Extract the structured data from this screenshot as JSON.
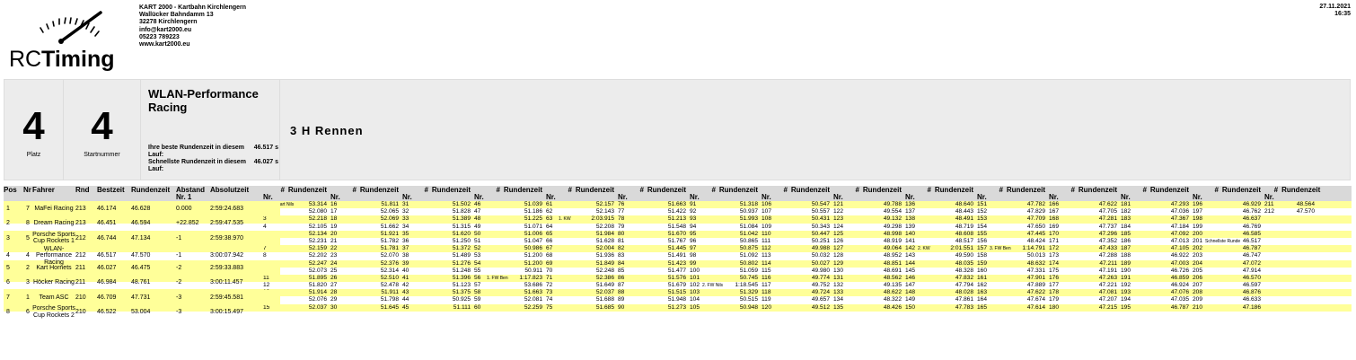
{
  "header": {
    "club_lines": [
      "KART 2000 - Kartbahn Kirchlengern",
      "Wallücker Bahndamm 13",
      "32278 Kirchlengern",
      "info@kart2000.eu",
      "05223 789223",
      "www.kart2000.eu"
    ],
    "date": "27.11.2021",
    "time": "16:35",
    "logo_text_rc": "RC",
    "logo_text_timing": "Timing"
  },
  "info": {
    "place": "4",
    "place_label": "Platz",
    "start_number": "4",
    "start_label": "Startnummer",
    "team_name": "WLAN-Performance Racing",
    "best_lap_label": "Ihre beste Rundenzeit in diesem Lauf:",
    "best_lap_value": "46.517 s",
    "fastest_lap_label": "Schnellste Rundenzeit in diesem Lauf:",
    "fastest_lap_value": "46.027 s",
    "race_title": "3 H Rennen"
  },
  "standings": {
    "headers": [
      "Pos",
      "Nr",
      "Fahrer",
      "Rnd",
      "Bestzeit",
      "Rundenzeit",
      "Abstand Nr. 1",
      "Absolutzeit"
    ],
    "rows": [
      [
        "1",
        "7",
        "MaFei Racing",
        "213",
        "46.174",
        "46.628",
        "0.000",
        "2:59:24.683"
      ],
      [
        "2",
        "8",
        "Dream Racing",
        "213",
        "46.451",
        "46.594",
        "+22.852",
        "2:59:47.535"
      ],
      [
        "3",
        "5",
        "Porsche Sports Cup Rockets 1",
        "212",
        "46.744",
        "47.134",
        "-1",
        "2:59:38.970"
      ],
      [
        "4",
        "4",
        "WLAN-Performance Racing",
        "212",
        "46.517",
        "47.570",
        "-1",
        "3:00:07.942"
      ],
      [
        "5",
        "2",
        "Kart Hornets",
        "211",
        "46.027",
        "46.475",
        "-2",
        "2:59:33.883"
      ],
      [
        "6",
        "3",
        "Höcker Racing",
        "211",
        "46.984",
        "48.761",
        "-2",
        "3:00:11.457"
      ],
      [
        "7",
        "1",
        "Team ASC",
        "210",
        "46.709",
        "47.731",
        "-3",
        "2:59:45.581"
      ],
      [
        "8",
        "6",
        "Porsche Sports Cup Rockets 2",
        "210",
        "46.522",
        "53.004",
        "-3",
        "3:00:15.497"
      ]
    ]
  },
  "laps": {
    "col_num_label": "#",
    "col_nr_label": "Nr.",
    "col_time_label": "Rundenzeit",
    "columns": [
      [
        [
          "1",
          "53.314",
          "Start Nils"
        ],
        [
          "2",
          "52.080",
          ""
        ],
        [
          "3",
          "52.218",
          ""
        ],
        [
          "4",
          "52.105",
          ""
        ],
        [
          "5",
          "52.134",
          ""
        ],
        [
          "6",
          "52.231",
          ""
        ],
        [
          "7",
          "52.159",
          ""
        ],
        [
          "8",
          "52.202",
          ""
        ],
        [
          "9",
          "52.247",
          ""
        ],
        [
          "10",
          "52.073",
          ""
        ],
        [
          "11",
          "51.895",
          ""
        ],
        [
          "12",
          "51.820",
          ""
        ],
        [
          "13",
          "51.914",
          ""
        ],
        [
          "14",
          "52.076",
          ""
        ],
        [
          "15",
          "52.037",
          ""
        ]
      ],
      [
        [
          "16",
          "51.811",
          ""
        ],
        [
          "17",
          "52.065",
          ""
        ],
        [
          "18",
          "52.069",
          ""
        ],
        [
          "19",
          "51.662",
          ""
        ],
        [
          "20",
          "51.921",
          ""
        ],
        [
          "21",
          "51.782",
          ""
        ],
        [
          "22",
          "51.781",
          ""
        ],
        [
          "23",
          "52.070",
          ""
        ],
        [
          "24",
          "52.376",
          ""
        ],
        [
          "25",
          "52.314",
          ""
        ],
        [
          "26",
          "52.510",
          ""
        ],
        [
          "27",
          "52.478",
          ""
        ],
        [
          "28",
          "51.911",
          ""
        ],
        [
          "29",
          "51.798",
          ""
        ],
        [
          "30",
          "51.645",
          ""
        ]
      ],
      [
        [
          "31",
          "51.502",
          ""
        ],
        [
          "32",
          "51.828",
          ""
        ],
        [
          "33",
          "51.389",
          ""
        ],
        [
          "34",
          "51.315",
          ""
        ],
        [
          "35",
          "51.620",
          ""
        ],
        [
          "36",
          "51.250",
          ""
        ],
        [
          "37",
          "51.372",
          ""
        ],
        [
          "38",
          "51.489",
          ""
        ],
        [
          "39",
          "51.276",
          ""
        ],
        [
          "40",
          "51.248",
          ""
        ],
        [
          "41",
          "51.396",
          ""
        ],
        [
          "42",
          "51.123",
          ""
        ],
        [
          "43",
          "51.375",
          ""
        ],
        [
          "44",
          "50.925",
          ""
        ],
        [
          "45",
          "51.111",
          ""
        ]
      ],
      [
        [
          "46",
          "51.039",
          ""
        ],
        [
          "47",
          "51.186",
          ""
        ],
        [
          "48",
          "51.225",
          ""
        ],
        [
          "49",
          "51.071",
          ""
        ],
        [
          "50",
          "51.006",
          ""
        ],
        [
          "51",
          "51.047",
          ""
        ],
        [
          "52",
          "50.986",
          ""
        ],
        [
          "53",
          "51.200",
          ""
        ],
        [
          "54",
          "51.200",
          ""
        ],
        [
          "55",
          "50.911",
          ""
        ],
        [
          "56",
          "1:17.823",
          "1. FW Ben"
        ],
        [
          "57",
          "53.686",
          ""
        ],
        [
          "58",
          "51.663",
          ""
        ],
        [
          "59",
          "52.081",
          ""
        ],
        [
          "60",
          "52.259",
          ""
        ]
      ],
      [
        [
          "61",
          "52.157",
          ""
        ],
        [
          "62",
          "52.143",
          ""
        ],
        [
          "63",
          "2:03.915",
          "1. KW"
        ],
        [
          "64",
          "52.208",
          ""
        ],
        [
          "65",
          "51.984",
          ""
        ],
        [
          "66",
          "51.628",
          ""
        ],
        [
          "67",
          "52.004",
          ""
        ],
        [
          "68",
          "51.936",
          ""
        ],
        [
          "69",
          "51.849",
          ""
        ],
        [
          "70",
          "52.248",
          ""
        ],
        [
          "71",
          "52.386",
          ""
        ],
        [
          "72",
          "51.649",
          ""
        ],
        [
          "73",
          "52.037",
          ""
        ],
        [
          "74",
          "51.688",
          ""
        ],
        [
          "75",
          "51.685",
          ""
        ]
      ],
      [
        [
          "76",
          "51.663",
          ""
        ],
        [
          "77",
          "51.422",
          ""
        ],
        [
          "78",
          "51.213",
          ""
        ],
        [
          "79",
          "51.548",
          ""
        ],
        [
          "80",
          "51.670",
          ""
        ],
        [
          "81",
          "51.767",
          ""
        ],
        [
          "82",
          "51.445",
          ""
        ],
        [
          "83",
          "51.491",
          ""
        ],
        [
          "84",
          "51.423",
          ""
        ],
        [
          "85",
          "51.477",
          ""
        ],
        [
          "86",
          "51.576",
          ""
        ],
        [
          "87",
          "51.679",
          ""
        ],
        [
          "88",
          "51.515",
          ""
        ],
        [
          "89",
          "51.948",
          ""
        ],
        [
          "90",
          "51.273",
          ""
        ]
      ],
      [
        [
          "91",
          "51.318",
          ""
        ],
        [
          "92",
          "50.937",
          ""
        ],
        [
          "93",
          "51.993",
          ""
        ],
        [
          "94",
          "51.084",
          ""
        ],
        [
          "95",
          "51.042",
          ""
        ],
        [
          "96",
          "50.865",
          ""
        ],
        [
          "97",
          "50.875",
          ""
        ],
        [
          "98",
          "51.092",
          ""
        ],
        [
          "99",
          "50.802",
          ""
        ],
        [
          "100",
          "51.059",
          ""
        ],
        [
          "101",
          "50.745",
          ""
        ],
        [
          "102",
          "1:18.545",
          "2. FW Nils"
        ],
        [
          "103",
          "51.329",
          ""
        ],
        [
          "104",
          "50.515",
          ""
        ],
        [
          "105",
          "50.948",
          ""
        ]
      ],
      [
        [
          "106",
          "50.547",
          ""
        ],
        [
          "107",
          "50.557",
          ""
        ],
        [
          "108",
          "50.431",
          ""
        ],
        [
          "109",
          "50.343",
          ""
        ],
        [
          "110",
          "50.447",
          ""
        ],
        [
          "111",
          "50.251",
          ""
        ],
        [
          "112",
          "49.988",
          ""
        ],
        [
          "113",
          "50.032",
          ""
        ],
        [
          "114",
          "50.027",
          ""
        ],
        [
          "115",
          "49.980",
          ""
        ],
        [
          "116",
          "49.774",
          ""
        ],
        [
          "117",
          "49.752",
          ""
        ],
        [
          "118",
          "49.724",
          ""
        ],
        [
          "119",
          "49.657",
          ""
        ],
        [
          "120",
          "49.512",
          ""
        ]
      ],
      [
        [
          "121",
          "49.788",
          ""
        ],
        [
          "122",
          "49.554",
          ""
        ],
        [
          "123",
          "49.132",
          ""
        ],
        [
          "124",
          "49.298",
          ""
        ],
        [
          "125",
          "48.998",
          ""
        ],
        [
          "126",
          "48.919",
          ""
        ],
        [
          "127",
          "49.064",
          ""
        ],
        [
          "128",
          "48.952",
          ""
        ],
        [
          "129",
          "48.851",
          ""
        ],
        [
          "130",
          "48.691",
          ""
        ],
        [
          "131",
          "48.562",
          ""
        ],
        [
          "132",
          "49.135",
          ""
        ],
        [
          "133",
          "48.622",
          ""
        ],
        [
          "134",
          "48.322",
          ""
        ],
        [
          "135",
          "48.426",
          ""
        ]
      ],
      [
        [
          "136",
          "48.640",
          ""
        ],
        [
          "137",
          "48.443",
          ""
        ],
        [
          "138",
          "48.491",
          ""
        ],
        [
          "139",
          "48.719",
          ""
        ],
        [
          "140",
          "48.608",
          ""
        ],
        [
          "141",
          "48.517",
          ""
        ],
        [
          "142",
          "2:01.551",
          "2. KW"
        ],
        [
          "143",
          "49.590",
          ""
        ],
        [
          "144",
          "48.035",
          ""
        ],
        [
          "145",
          "48.328",
          ""
        ],
        [
          "146",
          "47.832",
          ""
        ],
        [
          "147",
          "47.794",
          ""
        ],
        [
          "148",
          "48.028",
          ""
        ],
        [
          "149",
          "47.861",
          ""
        ],
        [
          "150",
          "47.783",
          ""
        ]
      ],
      [
        [
          "151",
          "47.782",
          ""
        ],
        [
          "152",
          "47.829",
          ""
        ],
        [
          "153",
          "47.709",
          ""
        ],
        [
          "154",
          "47.650",
          ""
        ],
        [
          "155",
          "47.445",
          ""
        ],
        [
          "156",
          "48.424",
          ""
        ],
        [
          "157",
          "1:14.791",
          "3. FW Ben"
        ],
        [
          "158",
          "50.013",
          ""
        ],
        [
          "159",
          "48.632",
          ""
        ],
        [
          "160",
          "47.331",
          ""
        ],
        [
          "161",
          "47.901",
          ""
        ],
        [
          "162",
          "47.889",
          ""
        ],
        [
          "163",
          "47.622",
          ""
        ],
        [
          "164",
          "47.674",
          ""
        ],
        [
          "165",
          "47.614",
          ""
        ]
      ],
      [
        [
          "166",
          "47.622",
          ""
        ],
        [
          "167",
          "47.705",
          ""
        ],
        [
          "168",
          "47.281",
          ""
        ],
        [
          "169",
          "47.737",
          ""
        ],
        [
          "170",
          "47.296",
          ""
        ],
        [
          "171",
          "47.352",
          ""
        ],
        [
          "172",
          "47.433",
          ""
        ],
        [
          "173",
          "47.288",
          ""
        ],
        [
          "174",
          "47.211",
          ""
        ],
        [
          "175",
          "47.191",
          ""
        ],
        [
          "176",
          "47.263",
          ""
        ],
        [
          "177",
          "47.221",
          ""
        ],
        [
          "178",
          "47.081",
          ""
        ],
        [
          "179",
          "47.207",
          ""
        ],
        [
          "180",
          "47.215",
          ""
        ]
      ],
      [
        [
          "181",
          "47.293",
          ""
        ],
        [
          "182",
          "47.036",
          ""
        ],
        [
          "183",
          "47.367",
          ""
        ],
        [
          "184",
          "47.184",
          ""
        ],
        [
          "185",
          "47.092",
          ""
        ],
        [
          "186",
          "47.013",
          ""
        ],
        [
          "187",
          "47.105",
          ""
        ],
        [
          "188",
          "46.922",
          ""
        ],
        [
          "189",
          "47.003",
          ""
        ],
        [
          "190",
          "46.726",
          ""
        ],
        [
          "191",
          "46.859",
          ""
        ],
        [
          "192",
          "46.924",
          ""
        ],
        [
          "193",
          "47.076",
          ""
        ],
        [
          "194",
          "47.035",
          ""
        ],
        [
          "195",
          "46.787",
          ""
        ]
      ],
      [
        [
          "196",
          "46.929",
          ""
        ],
        [
          "197",
          "46.762",
          ""
        ],
        [
          "198",
          "46.637",
          ""
        ],
        [
          "199",
          "46.769",
          ""
        ],
        [
          "200",
          "46.585",
          ""
        ],
        [
          "201",
          "46.517",
          "Schnellste Runde"
        ],
        [
          "202",
          "46.787",
          ""
        ],
        [
          "203",
          "46.747",
          ""
        ],
        [
          "204",
          "47.072",
          ""
        ],
        [
          "205",
          "47.914",
          ""
        ],
        [
          "206",
          "46.570",
          ""
        ],
        [
          "207",
          "46.597",
          ""
        ],
        [
          "208",
          "46.876",
          ""
        ],
        [
          "209",
          "46.633",
          ""
        ],
        [
          "210",
          "47.186",
          ""
        ]
      ],
      [
        [
          "211",
          "48.564",
          ""
        ],
        [
          "212",
          "47.570",
          ""
        ]
      ]
    ]
  }
}
